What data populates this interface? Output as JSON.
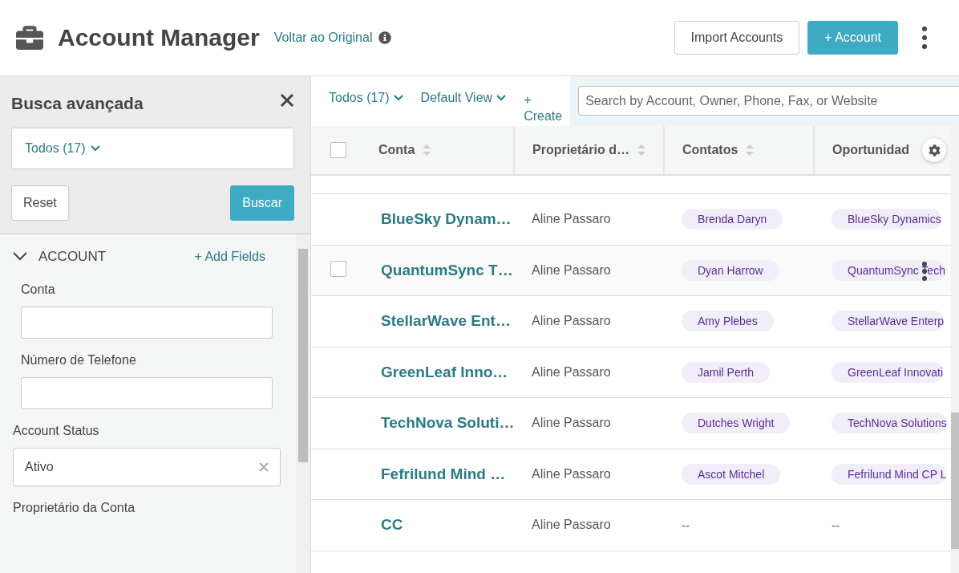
{
  "header": {
    "title": "Account Manager",
    "link": "Voltar ao Original",
    "buttons": [
      {
        "label": "Import Accounts",
        "kind": "secondary"
      },
      {
        "label": "+ Account",
        "kind": "primary"
      }
    ]
  },
  "sidebar": {
    "title": "Busca avançada",
    "view": "Todos (17)",
    "reset": "Reset",
    "search": "Buscar",
    "section": {
      "title": "ACCOUNT",
      "expanded": true,
      "add": "+ Add Fields"
    },
    "fields": [
      {
        "label": "Conta",
        "kind": "text",
        "indented": true
      },
      {
        "label": "Número de Telefone",
        "kind": "text",
        "indented": true
      },
      {
        "label": "Account Status",
        "kind": "select",
        "value": "Ativo",
        "indented": false
      },
      {
        "label": "Proprietário da Conta",
        "kind": "label",
        "indented": false
      }
    ]
  },
  "toolbar": {
    "filter": "Todos (17)",
    "view": "Default View",
    "create": [
      "+",
      "Create"
    ],
    "search_placeholder": "Search by Account, Owner, Phone, Fax, or Website"
  },
  "table": {
    "select_all": {
      "checked": false
    },
    "columns": [
      "Conta",
      "Proprietário d…",
      "Contatos",
      "Oportunidad"
    ],
    "rows": [
      {
        "account": "BlueSky Dynam…",
        "owner": "Aline Passaro",
        "contact": "Brenda Daryn",
        "opportunity": "BlueSky Dynamics",
        "hovered": false
      },
      {
        "account": "QuantumSync T…",
        "owner": "Aline Passaro",
        "contact": "Dyan Harrow",
        "opportunity": "QuantumSync Tech",
        "hovered": true
      },
      {
        "account": "StellarWave Ent…",
        "owner": "Aline Passaro",
        "contact": "Amy Plebes",
        "opportunity": "StellarWave Enterp",
        "hovered": false
      },
      {
        "account": "GreenLeaf Inno…",
        "owner": "Aline Passaro",
        "contact": "Jamil Perth",
        "opportunity": "GreenLeaf Innovati",
        "hovered": false
      },
      {
        "account": "TechNova Soluti…",
        "owner": "Aline Passaro",
        "contact": "Dutches Wright",
        "opportunity": "TechNova Solutions",
        "hovered": false
      },
      {
        "account": "Fefrilund Mind …",
        "owner": "Aline Passaro",
        "contact": "Ascot Mitchel",
        "opportunity": "Fefrilund Mind CP L",
        "hovered": false
      },
      {
        "account": "CC",
        "owner": "Aline Passaro",
        "contact": "--",
        "opportunity": "--",
        "hovered": false
      }
    ]
  }
}
